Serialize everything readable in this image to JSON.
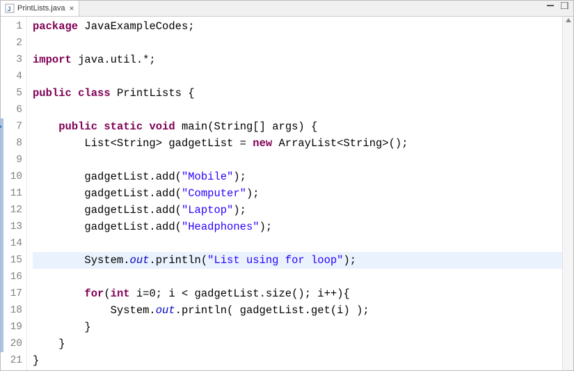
{
  "tab": {
    "filename": "PrintLists.java",
    "close": "×"
  },
  "lines": {
    "1": {
      "parts": [
        {
          "cls": "kw",
          "t": "package"
        },
        {
          "cls": "punct",
          "t": " JavaExampleCodes;"
        }
      ]
    },
    "2": {
      "parts": []
    },
    "3": {
      "parts": [
        {
          "cls": "kw",
          "t": "import"
        },
        {
          "cls": "punct",
          "t": " java.util.*;"
        }
      ]
    },
    "4": {
      "parts": []
    },
    "5": {
      "parts": [
        {
          "cls": "kw",
          "t": "public"
        },
        {
          "cls": "punct",
          "t": " "
        },
        {
          "cls": "kw",
          "t": "class"
        },
        {
          "cls": "punct",
          "t": " PrintLists {"
        }
      ]
    },
    "6": {
      "parts": []
    },
    "7": {
      "parts": [
        {
          "cls": "punct",
          "t": "    "
        },
        {
          "cls": "kw",
          "t": "public"
        },
        {
          "cls": "punct",
          "t": " "
        },
        {
          "cls": "kw",
          "t": "static"
        },
        {
          "cls": "punct",
          "t": " "
        },
        {
          "cls": "kw",
          "t": "void"
        },
        {
          "cls": "punct",
          "t": " main(String[] args) {"
        }
      ]
    },
    "8": {
      "parts": [
        {
          "cls": "punct",
          "t": "        List<String> gadgetList = "
        },
        {
          "cls": "kw",
          "t": "new"
        },
        {
          "cls": "punct",
          "t": " ArrayList<String>();"
        }
      ]
    },
    "9": {
      "parts": []
    },
    "10": {
      "parts": [
        {
          "cls": "punct",
          "t": "        gadgetList.add("
        },
        {
          "cls": "str",
          "t": "\"Mobile\""
        },
        {
          "cls": "punct",
          "t": ");"
        }
      ]
    },
    "11": {
      "parts": [
        {
          "cls": "punct",
          "t": "        gadgetList.add("
        },
        {
          "cls": "str",
          "t": "\"Computer\""
        },
        {
          "cls": "punct",
          "t": ");"
        }
      ]
    },
    "12": {
      "parts": [
        {
          "cls": "punct",
          "t": "        gadgetList.add("
        },
        {
          "cls": "str",
          "t": "\"Laptop\""
        },
        {
          "cls": "punct",
          "t": ");"
        }
      ]
    },
    "13": {
      "parts": [
        {
          "cls": "punct",
          "t": "        gadgetList.add("
        },
        {
          "cls": "str",
          "t": "\"Headphones\""
        },
        {
          "cls": "punct",
          "t": ");"
        }
      ]
    },
    "14": {
      "parts": []
    },
    "15": {
      "parts": [
        {
          "cls": "punct",
          "t": "        System."
        },
        {
          "cls": "field-italic",
          "t": "out"
        },
        {
          "cls": "punct",
          "t": ".println("
        },
        {
          "cls": "str",
          "t": "\"List using for loop\""
        },
        {
          "cls": "punct",
          "t": ");"
        }
      ]
    },
    "16": {
      "parts": []
    },
    "17": {
      "parts": [
        {
          "cls": "punct",
          "t": "        "
        },
        {
          "cls": "kw",
          "t": "for"
        },
        {
          "cls": "punct",
          "t": "("
        },
        {
          "cls": "kw",
          "t": "int"
        },
        {
          "cls": "punct",
          "t": " i=0; i < gadgetList.size(); i++){"
        }
      ]
    },
    "18": {
      "parts": [
        {
          "cls": "punct",
          "t": "            System."
        },
        {
          "cls": "field-italic",
          "t": "out"
        },
        {
          "cls": "punct",
          "t": ".println( gadgetList.get(i) );"
        }
      ]
    },
    "19": {
      "parts": [
        {
          "cls": "punct",
          "t": "        }"
        }
      ]
    },
    "20": {
      "parts": [
        {
          "cls": "punct",
          "t": "    }"
        }
      ]
    },
    "21": {
      "parts": [
        {
          "cls": "punct",
          "t": "}"
        }
      ]
    }
  },
  "currentLine": 15,
  "markedLines": [
    7,
    8,
    9,
    10,
    11,
    12,
    13,
    14,
    15,
    16,
    17,
    18,
    19,
    20
  ],
  "overrideLine": 7,
  "lineCount": 21
}
